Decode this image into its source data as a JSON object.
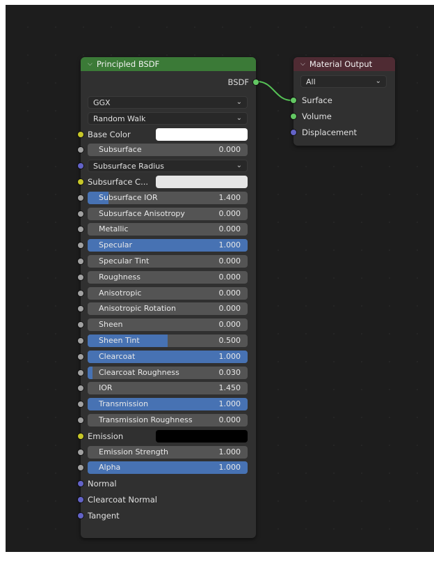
{
  "colors": {
    "shader_header": "#3b7a37",
    "output_header": "#4f2b33",
    "value_socket": "#a1a1a1",
    "color_socket": "#c7c729",
    "vector_socket": "#6363c7",
    "shader_socket": "#63c763",
    "slider_fill": "#4772b3"
  },
  "principled": {
    "title": "Principled BSDF",
    "output_label": "BSDF",
    "rows": [
      {
        "kind": "dropdown",
        "label": "GGX",
        "socket": null
      },
      {
        "kind": "dropdown",
        "label": "Random Walk",
        "socket": null
      },
      {
        "kind": "color",
        "label": "Base Color",
        "swatch": "#ffffff",
        "socket": "color"
      },
      {
        "kind": "slider",
        "label": "Subsurface",
        "value": "0.000",
        "fill": 0,
        "socket": "value"
      },
      {
        "kind": "dropdown",
        "label": "Subsurface Radius",
        "socket": "vector"
      },
      {
        "kind": "color",
        "label": "Subsurface C...",
        "swatch": "#e6e6e6",
        "socket": "color"
      },
      {
        "kind": "slider",
        "label": "Subsurface IOR",
        "value": "1.400",
        "fill": 0.13,
        "socket": "value"
      },
      {
        "kind": "slider",
        "label": "Subsurface Anisotropy",
        "value": "0.000",
        "fill": 0,
        "socket": "value"
      },
      {
        "kind": "slider",
        "label": "Metallic",
        "value": "0.000",
        "fill": 0,
        "socket": "value"
      },
      {
        "kind": "slider",
        "label": "Specular",
        "value": "1.000",
        "fill": 1,
        "socket": "value"
      },
      {
        "kind": "slider",
        "label": "Specular Tint",
        "value": "0.000",
        "fill": 0,
        "socket": "value"
      },
      {
        "kind": "slider",
        "label": "Roughness",
        "value": "0.000",
        "fill": 0,
        "socket": "value"
      },
      {
        "kind": "slider",
        "label": "Anisotropic",
        "value": "0.000",
        "fill": 0,
        "socket": "value"
      },
      {
        "kind": "slider",
        "label": "Anisotropic Rotation",
        "value": "0.000",
        "fill": 0,
        "socket": "value"
      },
      {
        "kind": "slider",
        "label": "Sheen",
        "value": "0.000",
        "fill": 0,
        "socket": "value"
      },
      {
        "kind": "slider",
        "label": "Sheen Tint",
        "value": "0.500",
        "fill": 0.5,
        "socket": "value"
      },
      {
        "kind": "slider",
        "label": "Clearcoat",
        "value": "1.000",
        "fill": 1,
        "socket": "value"
      },
      {
        "kind": "slider",
        "label": "Clearcoat Roughness",
        "value": "0.030",
        "fill": 0.03,
        "socket": "value"
      },
      {
        "kind": "slider",
        "label": "IOR",
        "value": "1.450",
        "fill": 0,
        "socket": "value"
      },
      {
        "kind": "slider",
        "label": "Transmission",
        "value": "1.000",
        "fill": 1,
        "socket": "value"
      },
      {
        "kind": "slider",
        "label": "Transmission Roughness",
        "value": "0.000",
        "fill": 0,
        "socket": "value"
      },
      {
        "kind": "color",
        "label": "Emission",
        "swatch": "#000000",
        "socket": "color"
      },
      {
        "kind": "slider",
        "label": "Emission Strength",
        "value": "1.000",
        "fill": 0,
        "socket": "value"
      },
      {
        "kind": "slider",
        "label": "Alpha",
        "value": "1.000",
        "fill": 1,
        "socket": "value"
      },
      {
        "kind": "input",
        "label": "Normal",
        "socket": "vector"
      },
      {
        "kind": "input",
        "label": "Clearcoat Normal",
        "socket": "vector"
      },
      {
        "kind": "input",
        "label": "Tangent",
        "socket": "vector"
      }
    ]
  },
  "material_output": {
    "title": "Material Output",
    "target": "All",
    "inputs": [
      {
        "label": "Surface",
        "socket": "shader"
      },
      {
        "label": "Volume",
        "socket": "shader"
      },
      {
        "label": "Displacement",
        "socket": "vector"
      }
    ]
  }
}
